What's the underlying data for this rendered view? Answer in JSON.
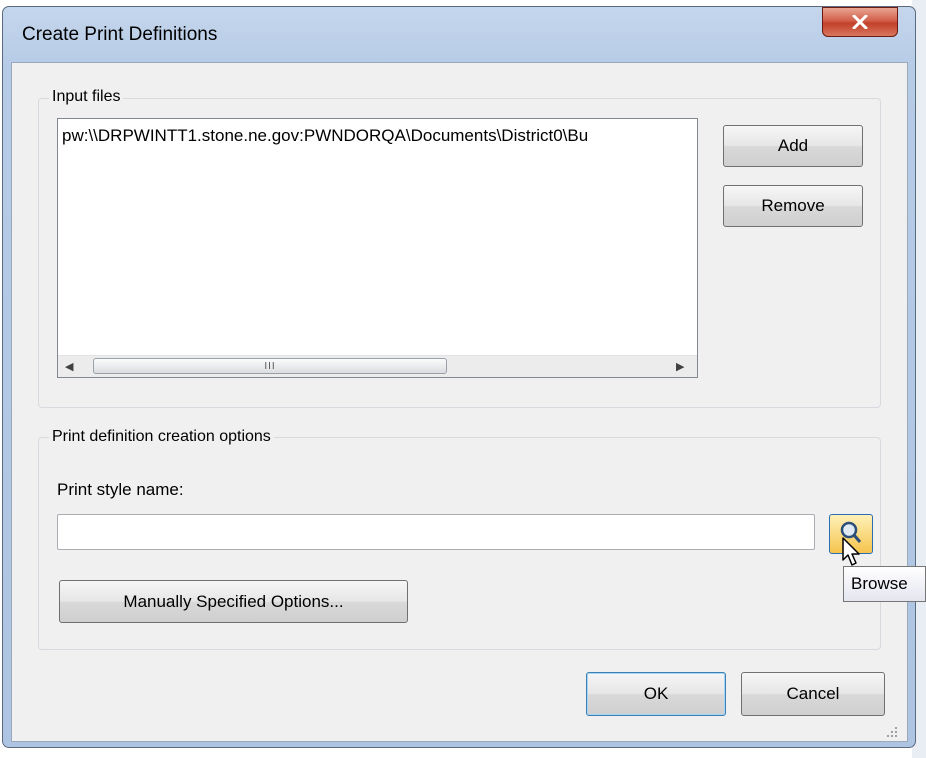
{
  "window": {
    "title": "Create Print Definitions"
  },
  "input_files": {
    "legend": "Input files",
    "items": [
      "pw:\\\\DRPWINTT1.stone.ne.gov:PWNDORQA\\Documents\\District0\\Bu"
    ],
    "scrollbar_grip": "III",
    "add_label": "Add",
    "remove_label": "Remove"
  },
  "options": {
    "legend": "Print definition creation options",
    "print_style_label": "Print style name:",
    "print_style_value": "",
    "manual_label": "Manually Specified Options...",
    "browse_tooltip": "Browse"
  },
  "footer": {
    "ok_label": "OK",
    "cancel_label": "Cancel"
  },
  "icons": {
    "close": "close-icon",
    "browse": "search-icon",
    "cursor": "pointer-cursor-icon",
    "grip": "resize-grip-icon"
  },
  "colors": {
    "close_button": "#c9452e",
    "browse_button": "#f5c44c",
    "default_button_border": "#3c7fb1"
  }
}
